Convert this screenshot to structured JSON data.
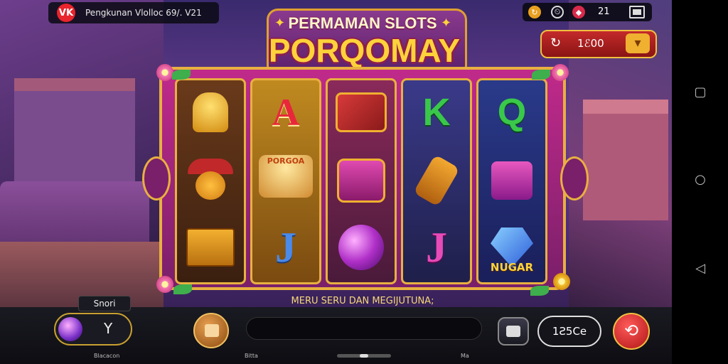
{
  "status_bar": {
    "logo_text": "VK",
    "text": "Pengkunan Vlolloc  69/. V21"
  },
  "hud": {
    "count": "21",
    "icons": [
      "refresh-icon",
      "clock-icon",
      "gem-icon",
      "window-icon"
    ]
  },
  "title": {
    "line1": "PERMAMAN SLOTS",
    "line2": "PORQOMAY"
  },
  "balance": {
    "value": "1ℰ00",
    "refresh_glyph": "↻",
    "dropdown_glyph": "▾"
  },
  "reels": [
    {
      "symbols": [
        {
          "icon": "golden-idol-icon",
          "text": ""
        },
        {
          "icon": "red-hat-character-icon",
          "text": ""
        },
        {
          "icon": "gold-box-icon",
          "text": ""
        }
      ]
    },
    {
      "symbols": [
        {
          "icon": "letter-a-icon",
          "text": "A"
        },
        {
          "icon": "treasure-cake-icon",
          "text": "PORGOA"
        },
        {
          "icon": "letter-j-icon",
          "text": "J"
        }
      ]
    },
    {
      "symbols": [
        {
          "icon": "golden-chest-icon",
          "text": ""
        },
        {
          "icon": "pink-pouch-icon",
          "text": ""
        },
        {
          "icon": "purple-orb-icon",
          "text": ""
        }
      ]
    },
    {
      "symbols": [
        {
          "icon": "letter-k-icon",
          "text": "K"
        },
        {
          "icon": "golden-scroll-icon",
          "text": ""
        },
        {
          "icon": "letter-j-icon",
          "text": "J"
        }
      ]
    },
    {
      "symbols": [
        {
          "icon": "letter-q-icon",
          "text": "Q"
        },
        {
          "icon": "pink-creature-box-icon",
          "text": ""
        },
        {
          "icon": "blue-gem-icon",
          "text": "NUGAR"
        }
      ]
    }
  ],
  "tagline": "MERU SERU DAN MEGIJUTUNA;",
  "bottom": {
    "left_tag": "Snori",
    "left_value": "Y",
    "left_label": "Blacacon",
    "mid_label_1": "Bitta",
    "mid_label_2": "Ma",
    "bet_value": "1Ƨ5Ce",
    "spin_glyph": "⟲"
  },
  "colors": {
    "frame": "#c02a8a",
    "gold": "#e8b040",
    "accent_red": "#c42a2a"
  }
}
